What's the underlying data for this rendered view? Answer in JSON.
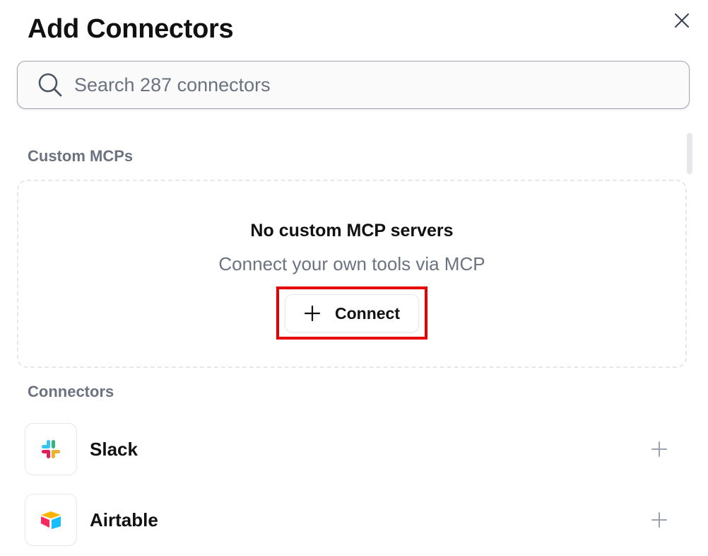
{
  "dialog": {
    "title": "Add Connectors",
    "close_icon": "close-icon"
  },
  "search": {
    "placeholder": "Search 287 connectors",
    "value": "",
    "icon": "search-icon"
  },
  "custom_mcps": {
    "section_label": "Custom MCPs",
    "empty_title": "No custom MCP servers",
    "empty_subtitle": "Connect your own tools via MCP",
    "connect_button": {
      "label": "Connect",
      "icon": "plus-icon",
      "highlight_color": "#e60000"
    }
  },
  "connectors": {
    "section_label": "Connectors",
    "items": [
      {
        "name": "Slack",
        "icon": "slack-logo-icon",
        "action_icon": "plus-icon"
      },
      {
        "name": "Airtable",
        "icon": "airtable-logo-icon",
        "action_icon": "plus-icon"
      }
    ]
  }
}
